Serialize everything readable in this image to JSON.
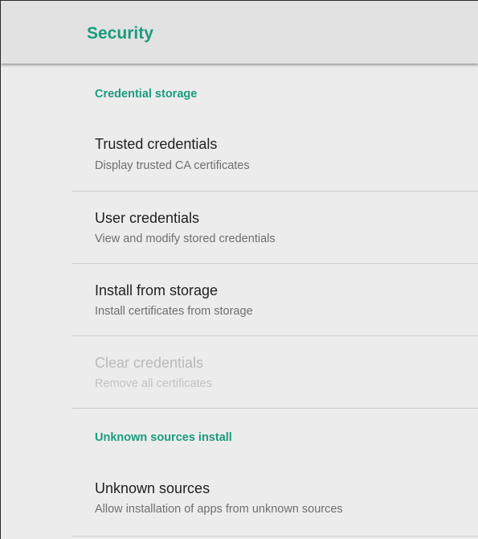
{
  "appbar": {
    "title": "Security"
  },
  "sections": [
    {
      "header": "Credential storage",
      "items": [
        {
          "title": "Trusted credentials",
          "summary": "Display trusted CA certificates",
          "enabled": true
        },
        {
          "title": "User credentials",
          "summary": "View and modify stored credentials",
          "enabled": true
        },
        {
          "title": "Install from storage",
          "summary": "Install certificates from storage",
          "enabled": true
        },
        {
          "title": "Clear credentials",
          "summary": "Remove all certificates",
          "enabled": false
        }
      ]
    },
    {
      "header": "Unknown sources install",
      "items": [
        {
          "title": "Unknown sources",
          "summary": "Allow installation of apps from unknown sources",
          "enabled": true
        }
      ]
    }
  ],
  "colors": {
    "accent": "#1a9c7c",
    "background": "#ececec",
    "appbar": "#e2e2e2",
    "disabled_text": "#b9b9b9"
  }
}
